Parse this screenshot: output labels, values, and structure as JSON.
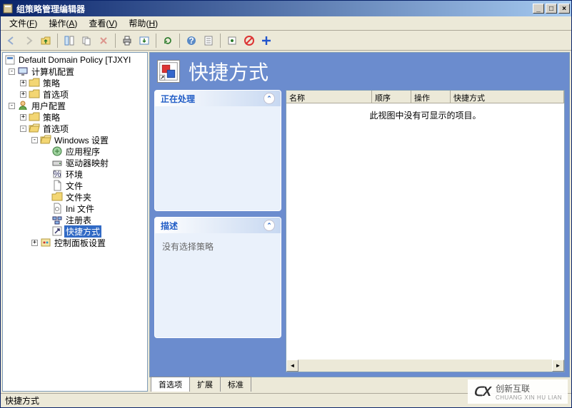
{
  "window": {
    "title": "组策略管理编辑器"
  },
  "menu": {
    "file": {
      "label": "文件",
      "accel": "F"
    },
    "action": {
      "label": "操作",
      "accel": "A"
    },
    "view": {
      "label": "查看",
      "accel": "V"
    },
    "help": {
      "label": "帮助",
      "accel": "H"
    }
  },
  "tree": {
    "root": "Default Domain Policy [TJXYI",
    "computer_cfg": "计算机配置",
    "policy": "策略",
    "pref": "首选项",
    "user_cfg": "用户配置",
    "win_settings": "Windows 设置",
    "apps": "应用程序",
    "drive_maps": "驱动器映射",
    "env": "环境",
    "files": "文件",
    "folders": "文件夹",
    "ini": "Ini 文件",
    "registry": "注册表",
    "shortcuts": "快捷方式",
    "ctrl_panel": "控制面板设置"
  },
  "header": {
    "title": "快捷方式"
  },
  "cards": {
    "processing": {
      "title": "正在处理"
    },
    "desc": {
      "title": "描述",
      "body": "没有选择策略"
    }
  },
  "list": {
    "cols": {
      "name": "名称",
      "order": "顺序",
      "action": "操作",
      "shortcut": "快捷方式"
    },
    "empty": "此视图中没有可显示的项目。"
  },
  "tabs": {
    "pref": "首选项",
    "ext": "扩展",
    "std": "标准"
  },
  "status": {
    "text": "快捷方式"
  },
  "watermark": {
    "brand": "创新互联",
    "sub": "CHUANG XIN HU LIAN"
  }
}
